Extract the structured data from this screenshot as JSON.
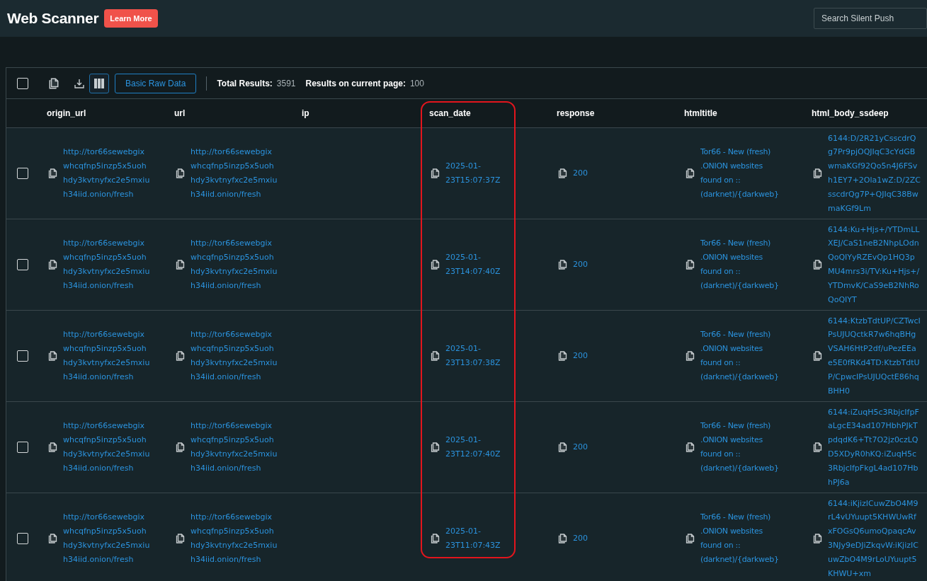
{
  "header": {
    "title": "Web Scanner",
    "learn_more": "Learn More",
    "search": {
      "placeholder": "Search Silent Push"
    }
  },
  "toolbar": {
    "select_all": {
      "checked": false
    },
    "columns_toggle": {
      "selected": true
    },
    "raw_button": "Basic Raw Data",
    "total_label": "Total Results:",
    "total_value": "3591",
    "page_label": "Results on current page:",
    "page_value": "100"
  },
  "table": {
    "columns": [
      {
        "label": "origin_url",
        "highlighted": false
      },
      {
        "label": "url",
        "highlighted": false
      },
      {
        "label": "ip",
        "highlighted": false
      },
      {
        "label": "scan_date",
        "highlighted": true
      },
      {
        "label": "response",
        "highlighted": false
      },
      {
        "label": "htmltitle",
        "highlighted": false
      },
      {
        "label": "html_body_ssdeep",
        "highlighted": false
      }
    ],
    "rows": [
      {
        "checked": false,
        "cells": [
          "http://tor66sewebgixwhcqfnp5inzp5x5uohhdy3kvtnyfxc2e5mxiuh34iid.onion/fresh",
          "http://tor66sewebgixwhcqfnp5inzp5x5uohhdy3kvtnyfxc2e5mxiuh34iid.onion/fresh",
          null,
          "2025-01-23T15:07:37Z",
          "200",
          "Tor66 - New (fresh) .ONION websites found on :: (darknet)/{darkweb}",
          "6144:D/2R21yCsscdrQg7Pr9pjOQJIqC3cYdGBwmaKGf92Qo5n4J6FSvh1EY7+2Ola1wZ:D/2ZCsscdrQg7P+QJIqC38BwmaKGf9Lm"
        ]
      },
      {
        "checked": false,
        "cells": [
          "http://tor66sewebgixwhcqfnp5inzp5x5uohhdy3kvtnyfxc2e5mxiuh34iid.onion/fresh",
          "http://tor66sewebgixwhcqfnp5inzp5x5uohhdy3kvtnyfxc2e5mxiuh34iid.onion/fresh",
          null,
          "2025-01-23T14:07:40Z",
          "200",
          "Tor66 - New (fresh) .ONION websites found on :: (darknet)/{darkweb}",
          "6144:Ku+Hjs+/YTDmLLXEJ/CaS1neB2NhpLOdnQoQIYyRZEvQp1HQ3pMU4mrs3i/TV:Ku+Hjs+/YTDmvK/CaS9eB2NhRoQoQIYT"
        ]
      },
      {
        "checked": false,
        "cells": [
          "http://tor66sewebgixwhcqfnp5inzp5x5uohhdy3kvtnyfxc2e5mxiuh34iid.onion/fresh",
          "http://tor66sewebgixwhcqfnp5inzp5x5uohhdy3kvtnyfxc2e5mxiuh34iid.onion/fresh",
          null,
          "2025-01-23T13:07:38Z",
          "200",
          "Tor66 - New (fresh) .ONION websites found on :: (darknet)/{darkweb}",
          "6144:KtzbTdtUP/CZTwcIPsUJUQctkR7w6hqBHgVSAH6HtP2df/uPezEEae5E0fRKd4TD:KtzbTdtUP/CpwcIPsUJUQctE86hqBHH0"
        ]
      },
      {
        "checked": false,
        "cells": [
          "http://tor66sewebgixwhcqfnp5inzp5x5uohhdy3kvtnyfxc2e5mxiuh34iid.onion/fresh",
          "http://tor66sewebgixwhcqfnp5inzp5x5uohhdy3kvtnyfxc2e5mxiuh34iid.onion/fresh",
          null,
          "2025-01-23T12:07:40Z",
          "200",
          "Tor66 - New (fresh) .ONION websites found on :: (darknet)/{darkweb}",
          "6144:iZuqH5c3RbjcIfpFaLgcE34ad107HbhPJkTpdqdK6+Tt7O2jz0czLQD5XDyR0hKQ:iZuqH5c3RbjcIfpFkgL4ad107HbhPJ6a"
        ]
      },
      {
        "checked": false,
        "cells": [
          "http://tor66sewebgixwhcqfnp5inzp5x5uohhdy3kvtnyfxc2e5mxiuh34iid.onion/fresh",
          "http://tor66sewebgixwhcqfnp5inzp5x5uohhdy3kvtnyfxc2e5mxiuh34iid.onion/fresh",
          null,
          "2025-01-23T11:07:43Z",
          "200",
          "Tor66 - New (fresh) .ONION websites found on :: (darknet)/{darkweb}",
          "6144:iKjizICuwZbO4M9rL4vUYuupt5KHWUwRfxFOGsQ6umoQpaqcAv3NJy9eDJiZkqvW:iKjizICuwZbO4M9rLoUYuupt5KHWU+xm"
        ]
      }
    ]
  }
}
